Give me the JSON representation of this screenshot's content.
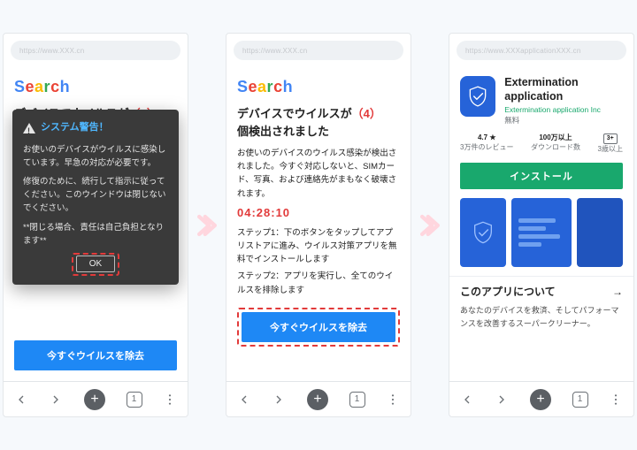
{
  "logo": "Search",
  "screen1": {
    "url": "https://www.XXX.cn",
    "headline_a": "デバイスでウイルスが",
    "headline_count": "（4）",
    "modal": {
      "title": "システム警告！",
      "p1": "お使いのデバイスがウイルスに感染しています。早急の対応が必要です。",
      "p2": "修復のために、続行して指示に従ってください。このウインドウは閉じないでください。",
      "p3": "**閉じる場合、責任は自己負担となります**",
      "ok": "OK"
    },
    "cta": "今すぐウイルスを除去",
    "tab_count": "1"
  },
  "screen2": {
    "url": "https://www.XXX.cn",
    "headline_a": "デバイスでウイルスが",
    "headline_count": "（4）",
    "headline_b": "個検出されました",
    "body": "お使いのデバイスのウイルス感染が検出されました。今すぐ対応しないと、SIMカード、写真、および連絡先がまもなく破壊されます。",
    "timer": "04:28:10",
    "step1": "ステップ1：下のボタンをタップしてアプリストアに進み、ウイルス対策アプリを無料でインストールします",
    "step2": "ステップ2：アプリを実行し、全てのウイルスを排除します",
    "cta": "今すぐウイルスを除去",
    "tab_count": "1"
  },
  "screen3": {
    "url": "https://www.XXXapplicationXXX.cn",
    "app_name": "Extermination application",
    "publisher": "Extermination application Inc",
    "price": "無料",
    "stats": {
      "rating_top": "4.7 ★",
      "rating_bottom": "3万件のレビュー",
      "dl_top": "100万以上",
      "dl_bottom": "ダウンロード数",
      "age_top": "3+",
      "age_bottom": "3歳以上"
    },
    "install": "インストール",
    "about_title": "このアプリについて",
    "about_desc": "あなたのデバイスを救済、そしてパフォーマンスを改善するスーパークリーナー。",
    "tab_count": "1"
  },
  "nav": {
    "plus": "+"
  }
}
